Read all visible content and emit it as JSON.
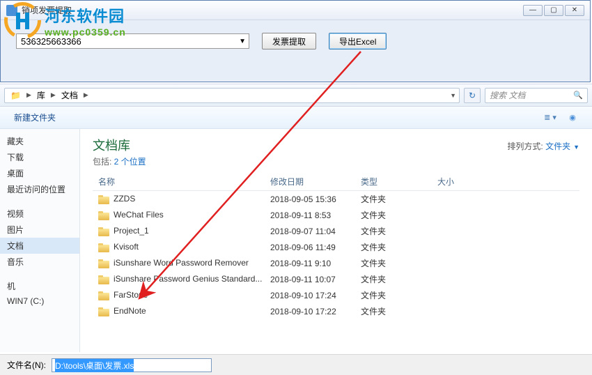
{
  "topDialog": {
    "title": "销项发票提取",
    "inputValue": "536325663366",
    "extractBtn": "发票提取",
    "exportBtn": "导出Excel"
  },
  "watermark": {
    "name": "河东软件园",
    "url": "www.pc0359.cn"
  },
  "addressBar": {
    "seg1": "库",
    "seg2": "文档"
  },
  "search": {
    "placeholder": "搜索 文档"
  },
  "toolbar": {
    "newFolder": "新建文件夹"
  },
  "sidebar": {
    "items": [
      {
        "label": "藏夹"
      },
      {
        "label": "下载"
      },
      {
        "label": "桌面"
      },
      {
        "label": "最近访问的位置"
      }
    ],
    "libItems": [
      {
        "label": "视频"
      },
      {
        "label": "图片"
      },
      {
        "label": "文档",
        "active": true
      },
      {
        "label": "音乐"
      }
    ],
    "sysItems": [
      {
        "label": "机"
      },
      {
        "label": "WIN7 (C:)"
      }
    ]
  },
  "library": {
    "title": "文档库",
    "subPrefix": "包括: ",
    "subCount": "2 个位置",
    "sortLabel": "排列方式:",
    "sortValue": "文件夹"
  },
  "columns": {
    "name": "名称",
    "date": "修改日期",
    "type": "类型",
    "size": "大小"
  },
  "files": [
    {
      "name": "ZZDS",
      "date": "2018-09-05 15:36",
      "type": "文件夹"
    },
    {
      "name": "WeChat Files",
      "date": "2018-09-11 8:53",
      "type": "文件夹"
    },
    {
      "name": "Project_1",
      "date": "2018-09-07 11:04",
      "type": "文件夹"
    },
    {
      "name": "Kvisoft",
      "date": "2018-09-06 11:49",
      "type": "文件夹"
    },
    {
      "name": "iSunshare Word Password Remover",
      "date": "2018-09-11 9:10",
      "type": "文件夹"
    },
    {
      "name": "iSunshare Password Genius Standard...",
      "date": "2018-09-11 10:07",
      "type": "文件夹"
    },
    {
      "name": "FarStone",
      "date": "2018-09-10 17:24",
      "type": "文件夹"
    },
    {
      "name": "EndNote",
      "date": "2018-09-10 17:22",
      "type": "文件夹"
    }
  ],
  "filename": {
    "label": "文件名(N):",
    "value": "D:\\tools\\桌面\\发票.xls"
  }
}
